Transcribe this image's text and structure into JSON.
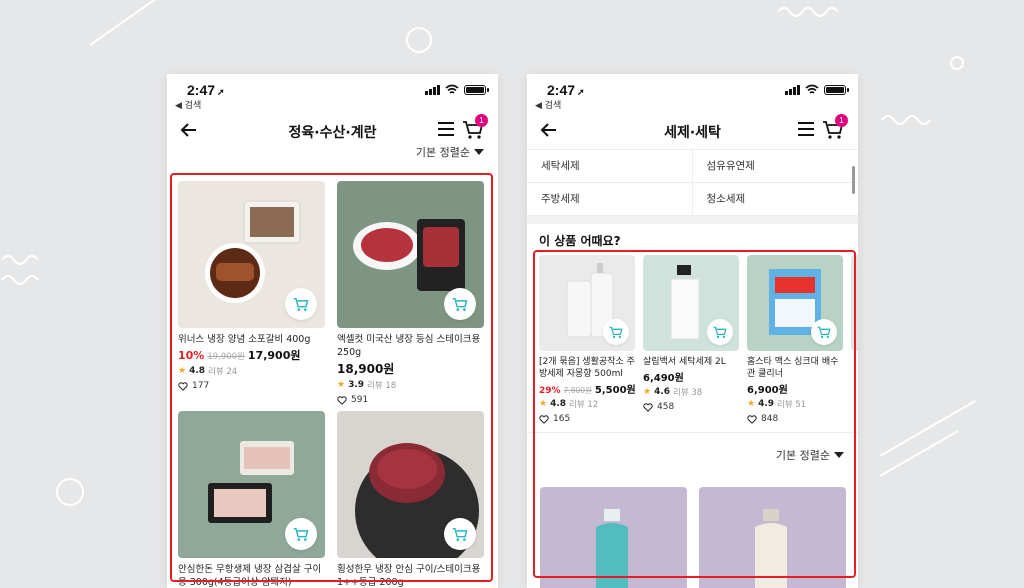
{
  "status_bar": {
    "time": "2:47",
    "back_app": "◀ 검색",
    "cart_count": "1"
  },
  "left_screen": {
    "title": "정육·수산·계란",
    "sort_label": "기본 정렬순",
    "products": [
      {
        "name": "위너스 냉장 양념 소포갈비 400g",
        "discount": "10%",
        "original_price": "19,900원",
        "price": "17,900원",
        "rating": "4.8",
        "review": "리뷰 24",
        "likes": "177"
      },
      {
        "name": "엑셀컷 미국산 냉장 등심 스테이크용 250g",
        "discount": "",
        "original_price": "",
        "price": "18,900원",
        "rating": "3.9",
        "review": "리뷰 18",
        "likes": "591"
      },
      {
        "name": "안심한돈 무항생제 냉장 삼겹살 구이용 300g(4등급이상 암퇘지)"
      },
      {
        "name": "횡성한우 냉장 안심 구이/스테이크용 1++등급 200g"
      }
    ]
  },
  "right_screen": {
    "title": "세제·세탁",
    "categories": [
      "세탁세제",
      "섬유유연제",
      "주방세제",
      "청소세제"
    ],
    "recommend_title": "이 상품 어때요?",
    "sort_label": "기본 정렬순",
    "recommend": [
      {
        "name": "[2개 묶음] 생활공작소 주방세제 자몽향 500ml",
        "discount": "29%",
        "original_price": "7,800원",
        "price": "5,500원",
        "rating": "4.8",
        "review": "리뷰 12",
        "likes": "165"
      },
      {
        "name": "살림백서 세탁세제 2L",
        "discount": "",
        "original_price": "",
        "price": "6,490원",
        "rating": "4.6",
        "review": "리뷰 38",
        "likes": "458"
      },
      {
        "name": "홈스타 맥스 싱크대 배수관 클리너",
        "discount": "",
        "original_price": "",
        "price": "6,900원",
        "rating": "4.9",
        "review": "리뷰 51",
        "likes": "848"
      }
    ]
  },
  "icons": [
    "back-arrow-icon",
    "menu-icon",
    "cart-icon",
    "heart-icon",
    "star-icon",
    "wifi-icon",
    "battery-icon",
    "signal-icon"
  ],
  "colors": {
    "highlight_border": "#e31e25",
    "badge": "#e6007e",
    "cart_button_icon": "#27b6c2",
    "discount": "#e31e25",
    "star": "#f5a623"
  }
}
